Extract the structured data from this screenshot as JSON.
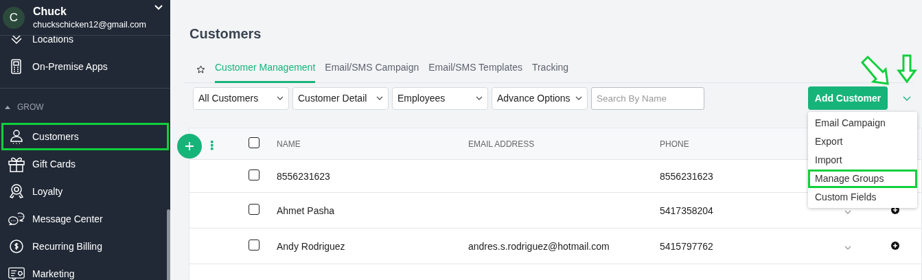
{
  "account": {
    "initial": "C",
    "name": "Chuck",
    "email": "chuckschicken12@gmail.com"
  },
  "sidebar": {
    "items": [
      {
        "kind": "item",
        "label": "Locations",
        "highlighted": false
      },
      {
        "kind": "item",
        "label": "On-Premise Apps",
        "highlighted": false
      },
      {
        "kind": "section",
        "label": "GROW",
        "expanded": true
      },
      {
        "kind": "item",
        "label": "Customers",
        "highlighted": true
      },
      {
        "kind": "item",
        "label": "Gift Cards",
        "highlighted": false
      },
      {
        "kind": "item",
        "label": "Loyalty",
        "highlighted": false
      },
      {
        "kind": "item",
        "label": "Message Center",
        "highlighted": false
      },
      {
        "kind": "item",
        "label": "Recurring Billing",
        "highlighted": false
      },
      {
        "kind": "item",
        "label": "Marketing",
        "highlighted": false
      }
    ]
  },
  "page": {
    "title": "Customers",
    "tabs": [
      {
        "label": "Customer Management",
        "selected": true
      },
      {
        "label": "Email/SMS Campaign",
        "selected": false
      },
      {
        "label": "Email/SMS Templates",
        "selected": false
      },
      {
        "label": "Tracking",
        "selected": false
      }
    ],
    "filters": [
      {
        "label": "All Customers"
      },
      {
        "label": "Customer Detail"
      },
      {
        "label": "Employees"
      },
      {
        "label": "Advance Options"
      }
    ],
    "search": {
      "placeholder": "Search By Name"
    },
    "add_button": "Add Customer",
    "menu": {
      "open": true,
      "items": [
        {
          "label": "Email Campaign",
          "highlighted": false
        },
        {
          "label": "Export",
          "highlighted": false
        },
        {
          "label": "Import",
          "highlighted": false
        },
        {
          "label": "Manage Groups",
          "highlighted": true
        },
        {
          "label": "Custom Fields",
          "highlighted": false
        }
      ]
    },
    "table": {
      "columns": [
        "NAME",
        "EMAIL ADDRESS",
        "PHONE"
      ],
      "all_checked": false,
      "rows": [
        {
          "name": "8556231623",
          "phone": "8556231623",
          "checked": false
        },
        {
          "name": "Ahmet Pasha",
          "phone": "5417358204",
          "checked": false
        },
        {
          "name": "Andy Rodriguez",
          "email": "andres.s.rodriguez@hotmail.com",
          "phone": "5415797762",
          "checked": false
        }
      ]
    }
  }
}
